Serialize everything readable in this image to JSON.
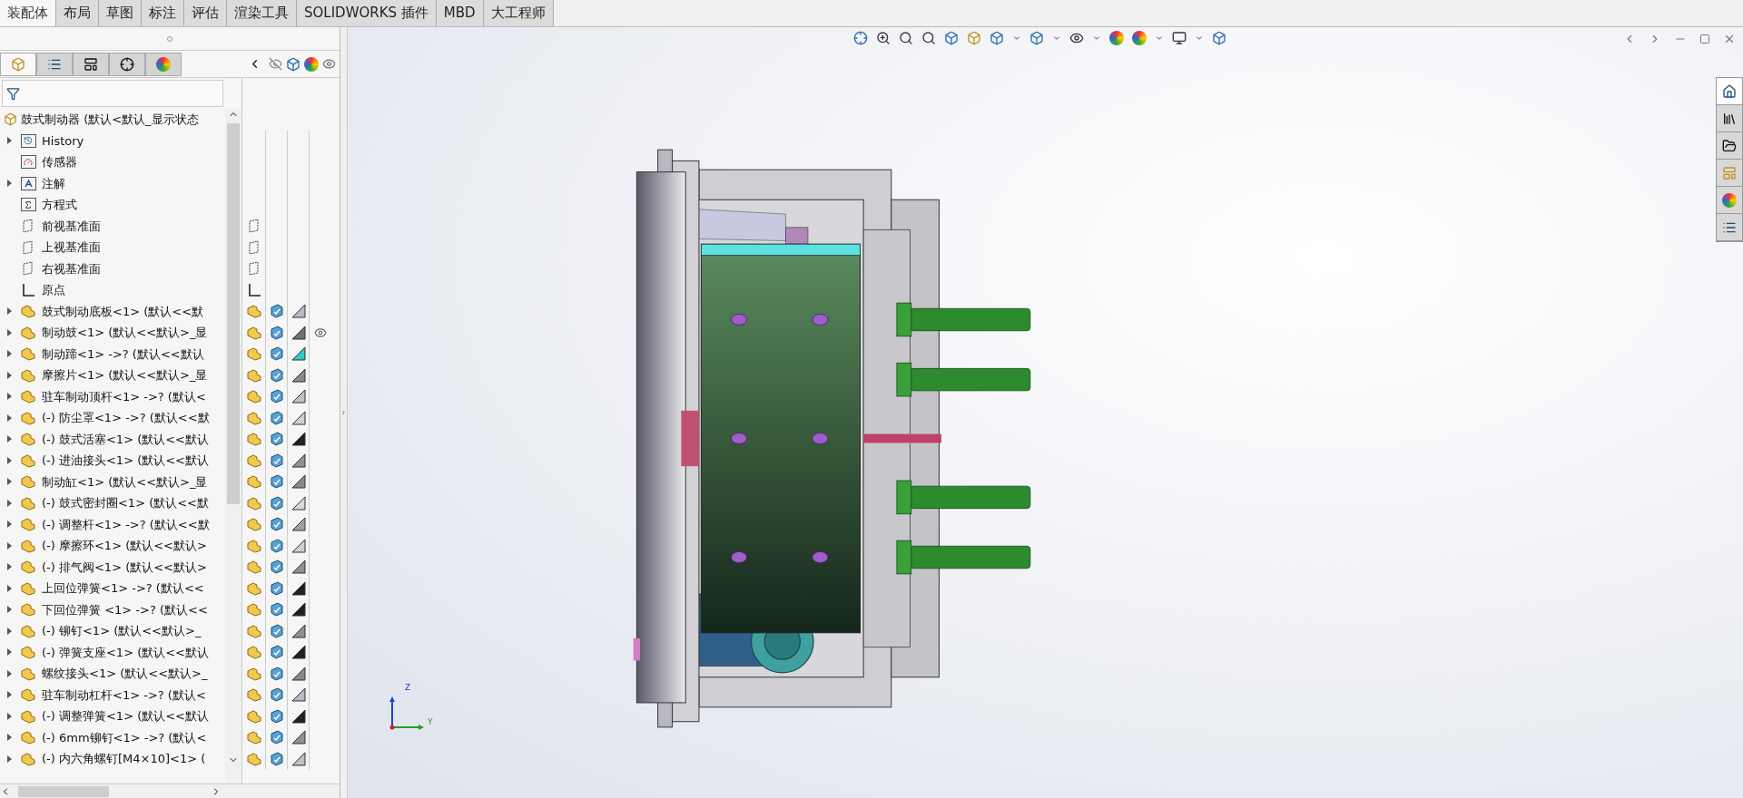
{
  "command_tabs": [
    {
      "label": "装配体",
      "selected": true
    },
    {
      "label": "布局",
      "selected": false
    },
    {
      "label": "草图",
      "selected": false
    },
    {
      "label": "标注",
      "selected": false
    },
    {
      "label": "评估",
      "selected": false
    },
    {
      "label": "渲染工具",
      "selected": false
    },
    {
      "label": "SOLIDWORKS 插件",
      "selected": false
    },
    {
      "label": "MBD",
      "selected": false
    },
    {
      "label": "大工程师",
      "selected": false
    }
  ],
  "panel_tabs": [
    {
      "kind": "features",
      "selected": true
    },
    {
      "kind": "properties",
      "selected": false
    },
    {
      "kind": "configurations",
      "selected": false
    },
    {
      "kind": "dimxpert",
      "selected": false
    },
    {
      "kind": "display",
      "selected": false
    }
  ],
  "tree": {
    "root": {
      "label": "鼓式制动器  (默认<默认_显示状态"
    },
    "items": [
      {
        "kind": "history",
        "label": "History",
        "expandable": true
      },
      {
        "kind": "sensors",
        "label": "传感器",
        "expandable": false
      },
      {
        "kind": "annotations",
        "label": "注解",
        "expandable": true
      },
      {
        "kind": "equations",
        "label": "方程式",
        "expandable": false
      },
      {
        "kind": "plane",
        "label": "前视基准面",
        "expandable": false
      },
      {
        "kind": "plane",
        "label": "上视基准面",
        "expandable": false
      },
      {
        "kind": "plane",
        "label": "右视基准面",
        "expandable": false
      },
      {
        "kind": "origin",
        "label": "原点",
        "expandable": false
      },
      {
        "kind": "part",
        "label": "鼓式制动底板<1> (默认<<默",
        "expandable": true,
        "color": "#b8b8c8",
        "eye": false
      },
      {
        "kind": "part",
        "label": "制动鼓<1> (默认<<默认>_显",
        "expandable": true,
        "color": "#707070",
        "eye": true
      },
      {
        "kind": "part",
        "label": "制动蹄<1> ->? (默认<<默认",
        "expandable": true,
        "color": "#30c8c8",
        "eye": false
      },
      {
        "kind": "part",
        "label": "摩擦片<1> (默认<<默认>_显",
        "expandable": true,
        "color": "#8a8a94",
        "eye": false
      },
      {
        "kind": "part",
        "label": "驻车制动顶杆<1> ->? (默认<",
        "expandable": true,
        "color": "#c0c0cc",
        "eye": false
      },
      {
        "kind": "part",
        "label": "(-) 防尘罩<1> ->? (默认<<默",
        "expandable": true,
        "color": "#d0d0d0",
        "eye": false
      },
      {
        "kind": "part",
        "label": "(-) 鼓式活塞<1> (默认<<默认",
        "expandable": true,
        "color": "#202020",
        "eye": false
      },
      {
        "kind": "part",
        "label": "(-) 进油接头<1> (默认<<默认",
        "expandable": true,
        "color": "#909090",
        "eye": false
      },
      {
        "kind": "part",
        "label": "制动缸<1> (默认<<默认>_显",
        "expandable": true,
        "color": "#8a8a8a",
        "eye": false
      },
      {
        "kind": "part",
        "label": "(-) 鼓式密封圈<1> (默认<<默",
        "expandable": true,
        "color": "#d8d8d8",
        "eye": false
      },
      {
        "kind": "part",
        "label": "(-) 调整杆<1> ->? (默认<<默",
        "expandable": true,
        "color": "#a0a0a0",
        "eye": false
      },
      {
        "kind": "part",
        "label": "(-) 摩擦环<1> (默认<<默认>",
        "expandable": true,
        "color": "#d0d0d0",
        "eye": false
      },
      {
        "kind": "part",
        "label": "(-) 排气阀<1> (默认<<默认>",
        "expandable": true,
        "color": "#909090",
        "eye": false
      },
      {
        "kind": "part",
        "label": "上回位弹簧<1> ->? (默认<<",
        "expandable": true,
        "color": "#202020",
        "eye": false
      },
      {
        "kind": "part",
        "label": "下回位弹簧 <1> ->? (默认<<",
        "expandable": true,
        "color": "#202020",
        "eye": false
      },
      {
        "kind": "part",
        "label": "(-) 铆钉<1> (默认<<默认>_",
        "expandable": true,
        "color": "#909090",
        "eye": false
      },
      {
        "kind": "part",
        "label": "(-) 弹簧支座<1> (默认<<默认",
        "expandable": true,
        "color": "#202020",
        "eye": false
      },
      {
        "kind": "part",
        "label": "螺纹接头<1> (默认<<默认>_",
        "expandable": true,
        "color": "#8a8a8a",
        "eye": false
      },
      {
        "kind": "part",
        "label": "驻车制动杠杆<1> ->? (默认<",
        "expandable": true,
        "color": "#b8b8c8",
        "eye": false
      },
      {
        "kind": "part",
        "label": "(-) 调整弹簧<1> (默认<<默认",
        "expandable": true,
        "color": "#202020",
        "eye": false
      },
      {
        "kind": "part",
        "label": "(-) 6mm铆钉<1> ->? (默认<",
        "expandable": true,
        "color": "#909090",
        "eye": false
      },
      {
        "kind": "part",
        "label": "(-) 内六角螺钉[M4×10]<1> (",
        "expandable": true,
        "color": "#c0c0c0",
        "eye": false
      }
    ]
  },
  "task_pane": [
    {
      "kind": "home",
      "selected": true
    },
    {
      "kind": "library",
      "selected": false
    },
    {
      "kind": "folder",
      "selected": false
    },
    {
      "kind": "palette",
      "selected": false
    },
    {
      "kind": "appearances",
      "selected": false
    },
    {
      "kind": "properties",
      "selected": false
    }
  ],
  "triad": {
    "z": "Z",
    "y": "Y"
  }
}
